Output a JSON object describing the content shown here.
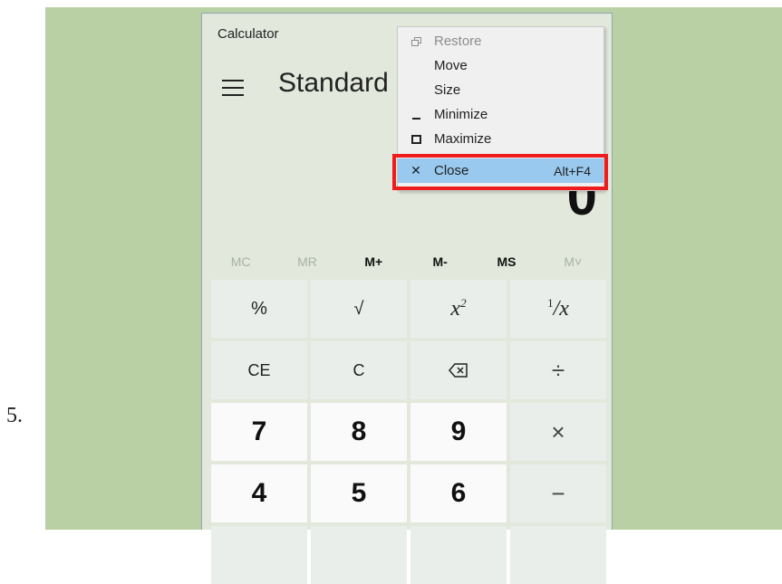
{
  "step_label": "5.",
  "window": {
    "title": "Calculator",
    "mode": "Standard",
    "display_value": "0"
  },
  "memory": [
    "MC",
    "MR",
    "M+",
    "M-",
    "MS",
    "M˅"
  ],
  "keys": {
    "percent": "%",
    "sqrt": "√",
    "ce": "CE",
    "c": "C",
    "divide": "÷",
    "seven": "7",
    "eight": "8",
    "nine": "9",
    "multiply": "×",
    "four": "4",
    "five": "5",
    "six": "6",
    "minus": "−"
  },
  "context_menu": {
    "restore": "Restore",
    "move": "Move",
    "size": "Size",
    "minimize": "Minimize",
    "maximize": "Maximize",
    "close": "Close",
    "close_shortcut": "Alt+F4"
  },
  "colors": {
    "backdrop": "#b9d0a4",
    "window": "#e2e9dc",
    "menu_highlight": "#99c9ee",
    "annotation_box": "#ee1c1c"
  }
}
